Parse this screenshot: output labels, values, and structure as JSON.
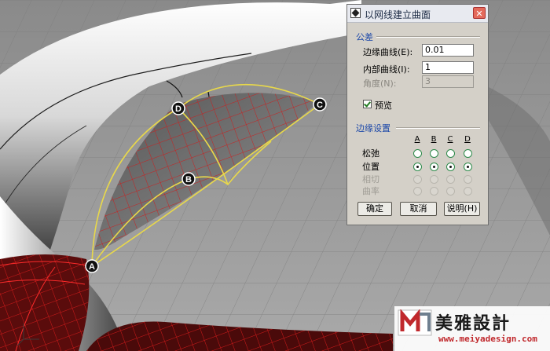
{
  "viewport": {
    "points": {
      "a": "A",
      "b": "B",
      "c": "C",
      "d": "D"
    }
  },
  "dialog": {
    "title": "以网线建立曲面",
    "tolerance_heading": "公差",
    "edge_curves_label": "边缘曲线(E):",
    "edge_curves_value": "0.01",
    "interior_curves_label": "内部曲线(I):",
    "interior_curves_value": "1",
    "angle_label": "角度(N):",
    "angle_value": "3",
    "preview_label": "预览",
    "preview_checked": true,
    "edge_settings_heading": "边缘设置",
    "columns": [
      "A",
      "B",
      "C",
      "D"
    ],
    "rows": {
      "loose": "松弛",
      "position": "位置",
      "tangency": "相切",
      "curvature": "曲率"
    },
    "selected_row": "position",
    "ok_label": "确定",
    "cancel_label": "取消",
    "help_label": "说明(H)"
  },
  "watermark": {
    "name": "美雅設計",
    "url": "www.meiyadesign.com"
  },
  "colors": {
    "surface_wire": "#d11a1a",
    "edge_curve": "#e8d84a",
    "dialog_bg": "#d4d0c8",
    "section_heading": "#1b47a8"
  }
}
